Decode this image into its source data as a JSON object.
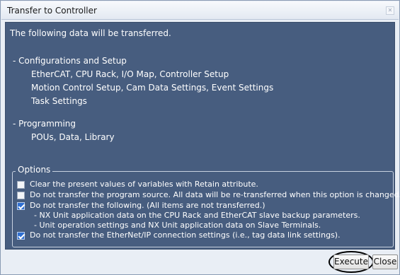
{
  "window": {
    "title": "Transfer to Controller"
  },
  "intro": "The following data will be transferred.",
  "sections": [
    {
      "heading": "- Configurations and Setup",
      "lines": [
        "EtherCAT, CPU Rack, I/O Map, Controller Setup",
        "Motion Control Setup, Cam Data Settings, Event Settings",
        "Task Settings"
      ]
    },
    {
      "heading": "- Programming",
      "lines": [
        "POUs, Data, Library"
      ]
    }
  ],
  "options": {
    "legend": "Options",
    "items": [
      {
        "label": "Clear the present values of variables with Retain attribute.",
        "checked": false
      },
      {
        "label": "Do not transfer the program source. All data will be re-transferred when this option is changed.",
        "checked": false
      },
      {
        "label": "Do not transfer the following. (All items are not transferred.)",
        "checked": true,
        "sub": [
          "- NX Unit application data on the CPU Rack and EtherCAT slave backup parameters.",
          "- Unit operation settings and NX Unit application data on Slave Terminals."
        ]
      },
      {
        "label": "Do not transfer the EtherNet/IP connection settings (i.e., tag data link settings).",
        "checked": true
      }
    ]
  },
  "buttons": {
    "execute": "Execute",
    "close": "Close"
  }
}
